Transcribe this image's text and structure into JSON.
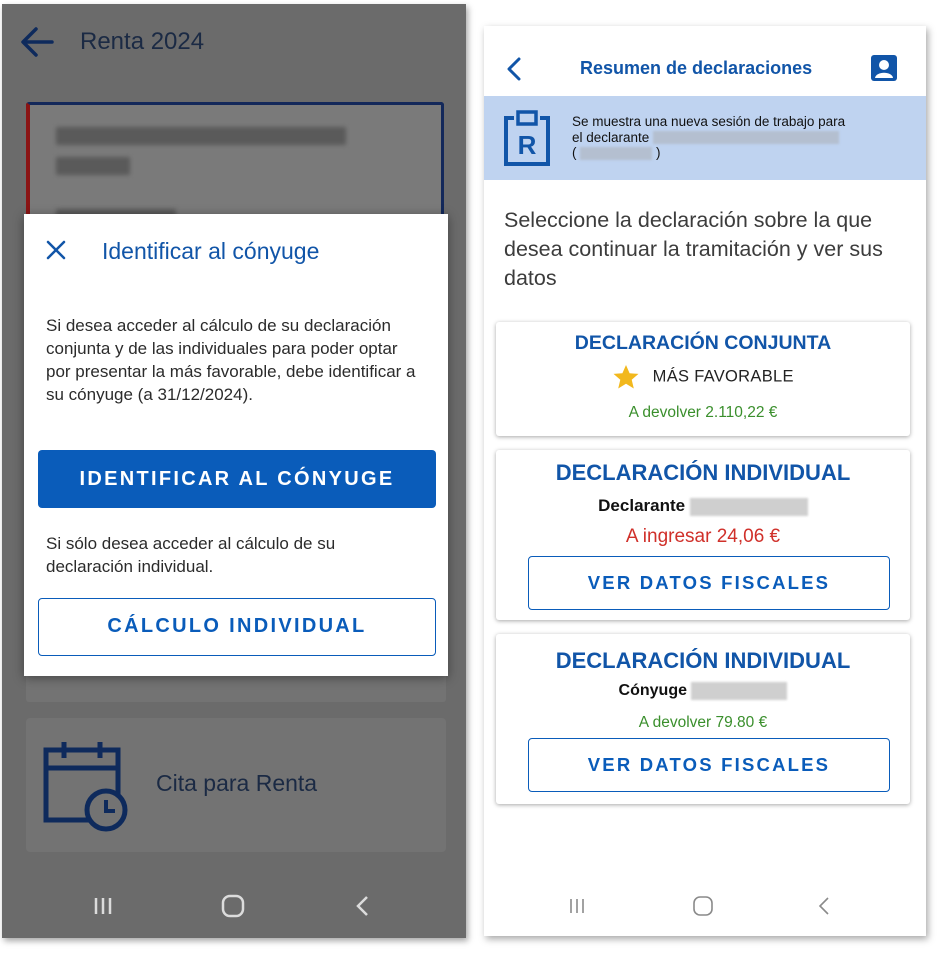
{
  "left_screen": {
    "header": {
      "title": "Renta 2024"
    },
    "cita": {
      "label": "Cita para Renta"
    },
    "dialog": {
      "title": "Identificar al cónyuge",
      "text1": "Si desea acceder al cálculo de su declaración conjunta y de las individuales para poder optar por presentar la más favorable, debe identificar a su cónyuge (a 31/12/2024).",
      "primary_button": "IDENTIFICAR AL CÓNYUGE",
      "text2": "Si sólo desea acceder al cálculo de su declaración individual.",
      "secondary_button": "CÁLCULO INDIVIDUAL"
    }
  },
  "right_screen": {
    "header": {
      "title": "Resumen de declaraciones"
    },
    "banner": {
      "line1": "Se muestra una nueva sesión de trabajo para",
      "line2": "el declarante",
      "open_paren": "(",
      "close_paren": ")"
    },
    "prompt": "Seleccione la declaración sobre la que desea continuar la tramitación y ver sus datos",
    "cards": [
      {
        "title": "DECLARACIÓN CONJUNTA",
        "badge": "MÁS FAVORABLE",
        "amount": "A devolver 2.110,22 €"
      },
      {
        "title": "DECLARACIÓN INDIVIDUAL",
        "person": "Declarante",
        "amount": "A ingresar 24,06 €",
        "button": "VER DATOS FISCALES"
      },
      {
        "title": "DECLARACIÓN INDIVIDUAL",
        "person": "Cónyuge",
        "amount": "A devolver 79.80 €",
        "button": "VER DATOS FISCALES"
      }
    ]
  },
  "icons": {
    "back_arrow": "arrow-left-icon",
    "close": "close-icon",
    "calendar": "calendar-clock-icon",
    "chevron": "chevron-left-icon",
    "profile": "profile-icon",
    "renta_logo": "renta-logo-icon",
    "star": "star-icon",
    "nav_recents": "recents-icon",
    "nav_home": "home-icon",
    "nav_back": "nav-back-icon"
  },
  "colors": {
    "brand_blue": "#0a5cba",
    "title_blue": "#1155a8",
    "banner_bg": "#bfd3f0",
    "positive": "#3a8f2c",
    "negative": "#d0302a",
    "star": "#f2b81d",
    "overlay": "#6b6b6b"
  }
}
